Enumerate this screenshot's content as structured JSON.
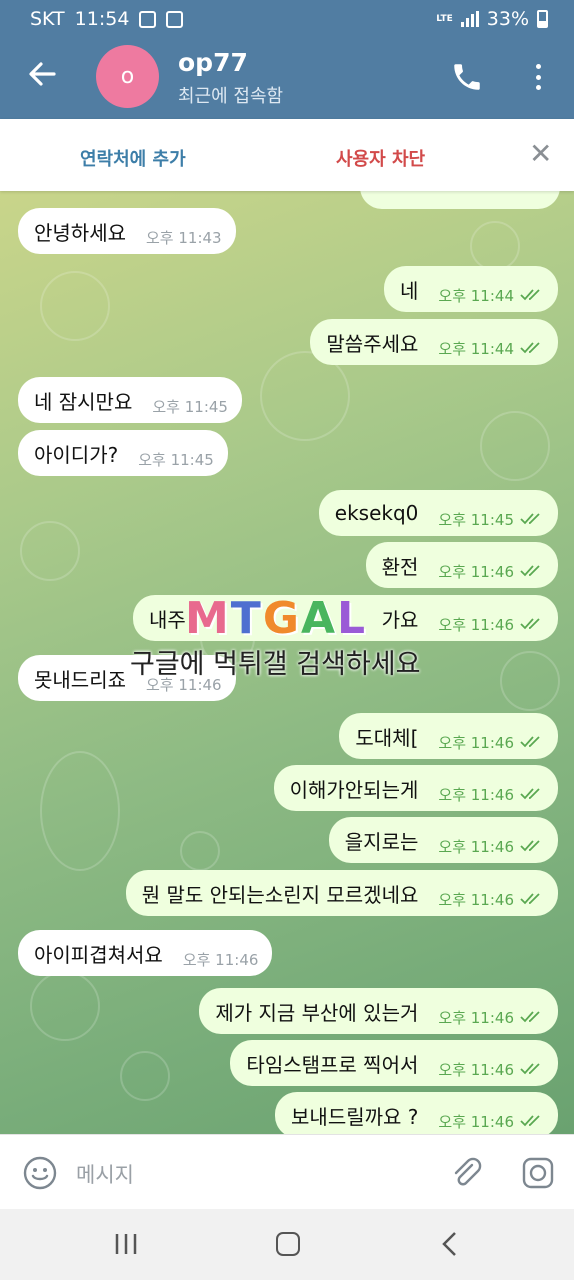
{
  "status_bar": {
    "carrier": "SKT",
    "time": "11:54",
    "network": "LTE",
    "battery": "33%"
  },
  "header": {
    "avatar_letter": "o",
    "name": "op77",
    "subtitle": "최근에 접속함"
  },
  "action_bar": {
    "add_contact": "연락처에 추가",
    "block_user": "사용자 차단"
  },
  "messages": [
    {
      "dir": "in",
      "text": "안녕하세요",
      "time": "오후 11:43"
    },
    {
      "dir": "out",
      "text": "네",
      "time": "오후 11:44"
    },
    {
      "dir": "out",
      "text": "말씀주세요",
      "time": "오후 11:44"
    },
    {
      "dir": "in",
      "text": "네 잠시만요",
      "time": "오후 11:45"
    },
    {
      "dir": "in",
      "text": "아이디가?",
      "time": "오후 11:45"
    },
    {
      "dir": "out",
      "text": "eksekq0",
      "time": "오후 11:45"
    },
    {
      "dir": "out",
      "text": "환전",
      "time": "오후 11:46"
    },
    {
      "dir": "out",
      "text": "내주",
      "text_end": "가요",
      "time": "오후 11:46"
    },
    {
      "dir": "in",
      "text": "못내드리죠",
      "time": "오후 11:46"
    },
    {
      "dir": "out",
      "text": "도대체[",
      "time": "오후 11:46"
    },
    {
      "dir": "out",
      "text": "이해가안되는게",
      "time": "오후 11:46"
    },
    {
      "dir": "out",
      "text": "을지로는",
      "time": "오후 11:46"
    },
    {
      "dir": "out",
      "text": "뭔 말도 안되는소린지 모르겠네요",
      "time": "오후 11:46"
    },
    {
      "dir": "in",
      "text": "아이피겹쳐서요",
      "time": "오후 11:46"
    },
    {
      "dir": "out",
      "text": "제가 지금 부산에 있는거",
      "time": "오후 11:46"
    },
    {
      "dir": "out",
      "text": "타임스탬프로 찍어서",
      "time": "오후 11:46"
    },
    {
      "dir": "out",
      "text": "보내드릴까요 ?",
      "time": "오후 11:46"
    }
  ],
  "watermark": {
    "logo": "MTGAL",
    "text": "구글에 먹튀갤 검색하세요"
  },
  "input": {
    "placeholder": "메시지"
  },
  "colors": {
    "header": "#517da2",
    "outgoing_bubble": "#efffde",
    "incoming_bubble": "#ffffff",
    "read_tick": "#5aa851",
    "block": "#d24a4a"
  },
  "icons": [
    "back-arrow-icon",
    "phone-icon",
    "more-vert-icon",
    "close-icon",
    "emoji-icon",
    "attach-icon",
    "camera-icon"
  ]
}
